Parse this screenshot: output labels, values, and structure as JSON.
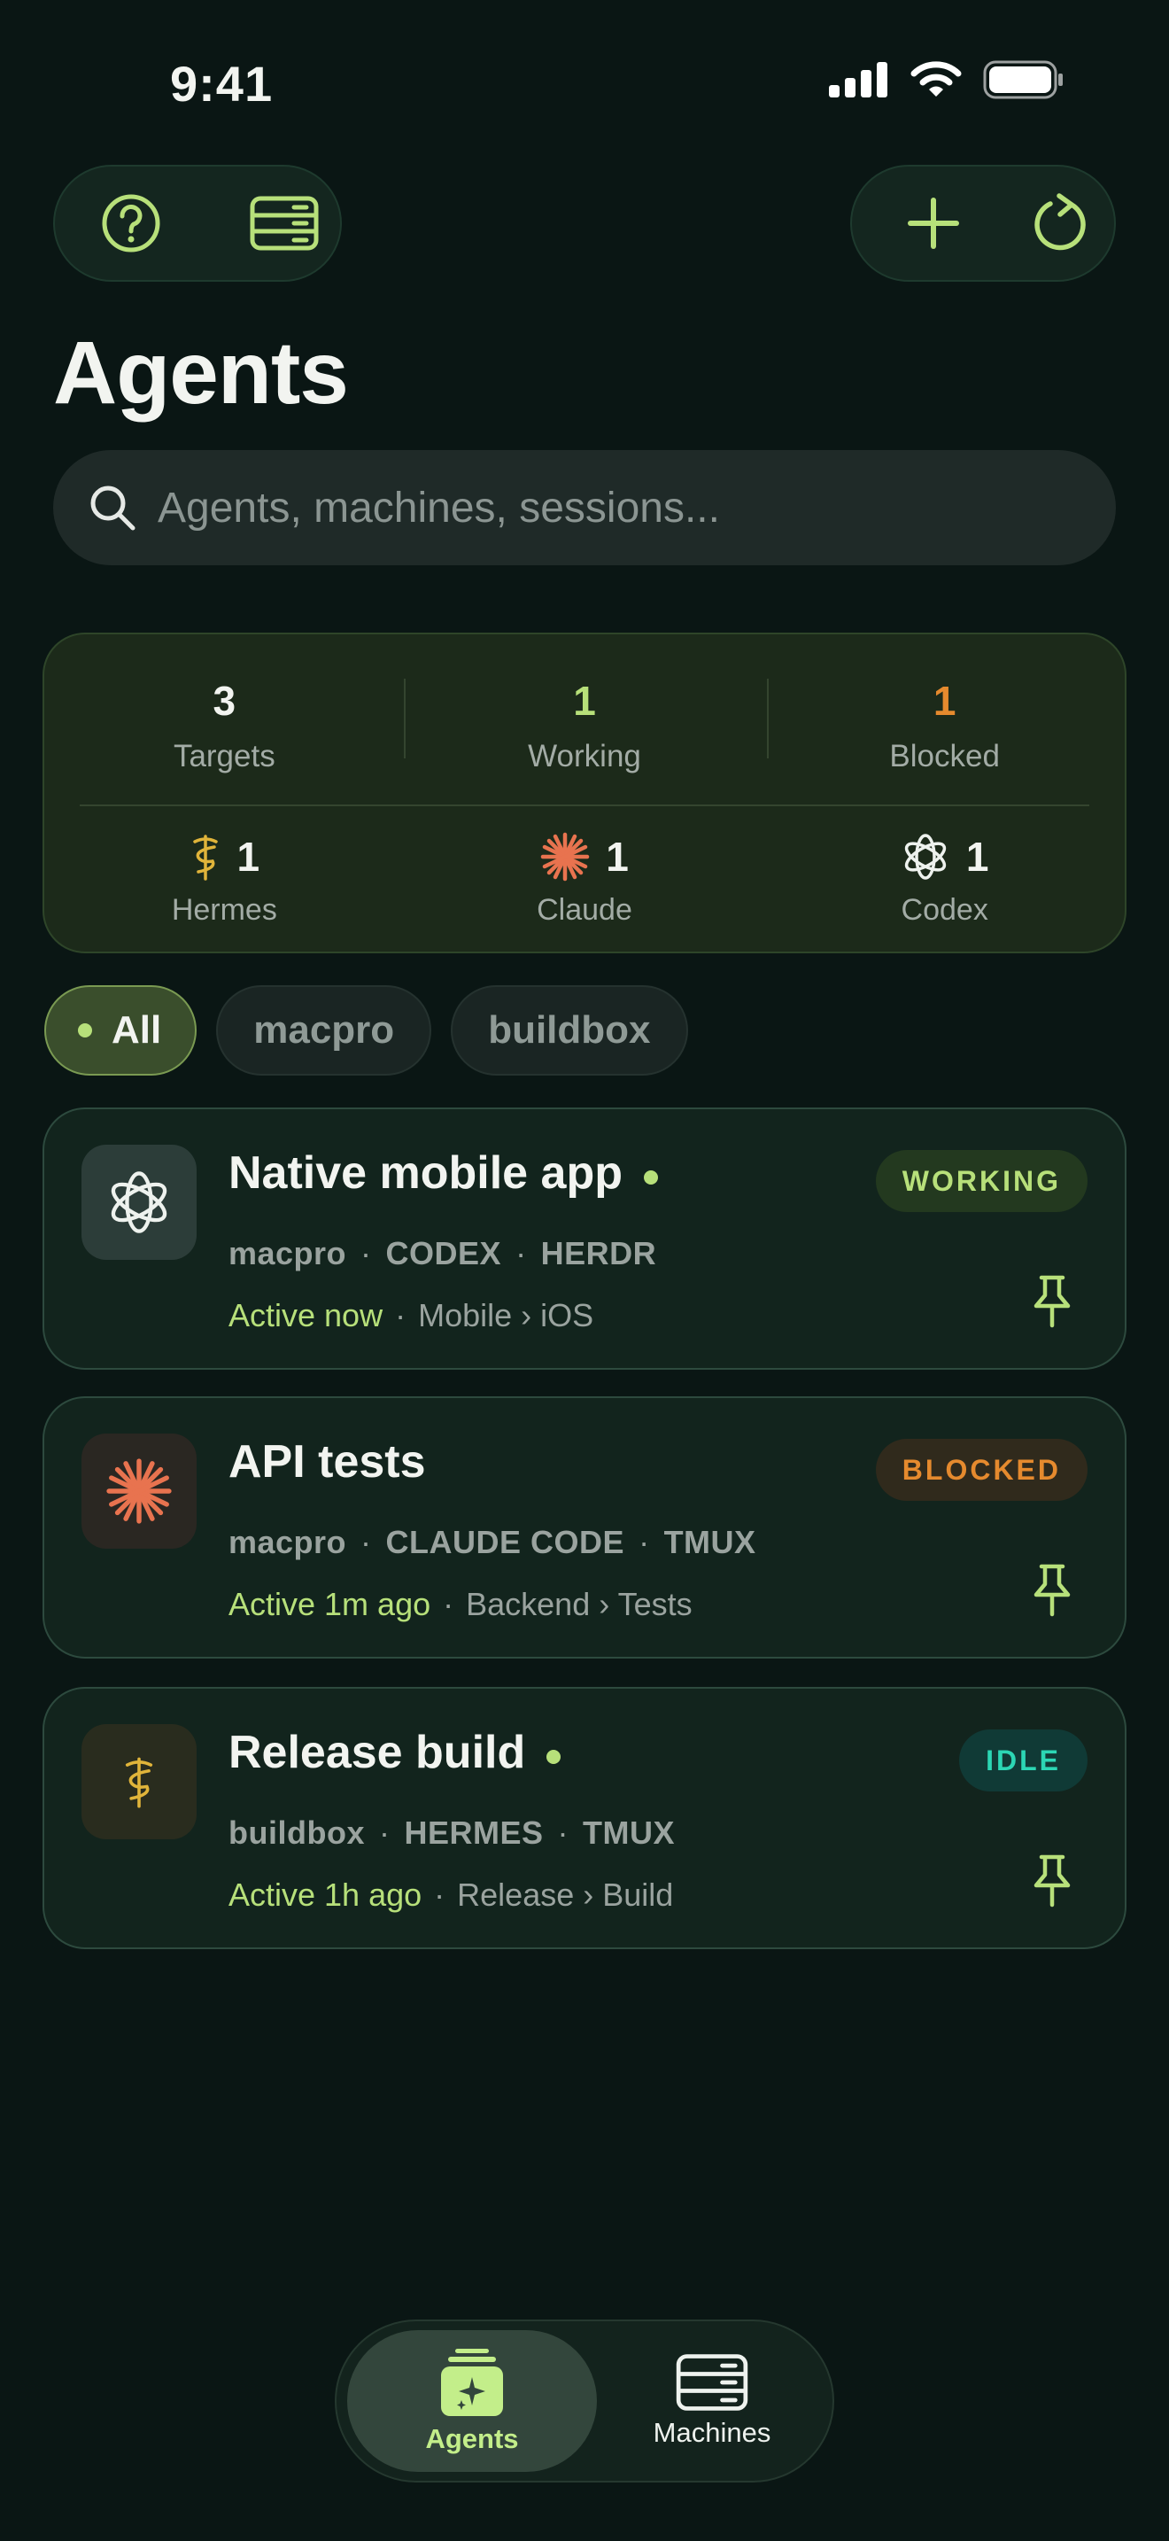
{
  "status_bar": {
    "time": "9:41"
  },
  "page": {
    "title": "Agents"
  },
  "search": {
    "placeholder": "Agents, machines, sessions..."
  },
  "summary": {
    "targets": {
      "count": "3",
      "label": "Targets"
    },
    "working": {
      "count": "1",
      "label": "Working"
    },
    "blocked": {
      "count": "1",
      "label": "Blocked"
    },
    "providers": [
      {
        "name": "Hermes",
        "count": "1",
        "icon": "caduceus-icon"
      },
      {
        "name": "Claude",
        "count": "1",
        "icon": "claude-starburst-icon"
      },
      {
        "name": "Codex",
        "count": "1",
        "icon": "openai-icon"
      }
    ]
  },
  "filters": [
    {
      "label": "All",
      "active": true
    },
    {
      "label": "macpro",
      "active": false
    },
    {
      "label": "buildbox",
      "active": false
    }
  ],
  "agents": [
    {
      "title": "Native mobile app",
      "online": true,
      "machine": "macpro",
      "tool": "CODEX",
      "session": "HERDR",
      "activity": "Active now",
      "path": "Mobile › iOS",
      "status": "WORKING",
      "icon": "openai-icon"
    },
    {
      "title": "API tests",
      "online": false,
      "machine": "macpro",
      "tool": "CLAUDE CODE",
      "session": "TMUX",
      "activity": "Active 1m ago",
      "path": "Backend › Tests",
      "status": "BLOCKED",
      "icon": "claude-starburst-icon"
    },
    {
      "title": "Release build",
      "online": true,
      "machine": "buildbox",
      "tool": "HERMES",
      "session": "TMUX",
      "activity": "Active 1h ago",
      "path": "Release › Build",
      "status": "IDLE",
      "icon": "caduceus-icon"
    }
  ],
  "tabbar": {
    "agents_label": "Agents",
    "machines_label": "Machines"
  },
  "colors": {
    "background": "#0a1614",
    "accent": "#b7e07a",
    "blocked": "#e58a2e",
    "idle": "#2cd6b4",
    "claude": "#e8734f",
    "hermes": "#e0b43a"
  }
}
